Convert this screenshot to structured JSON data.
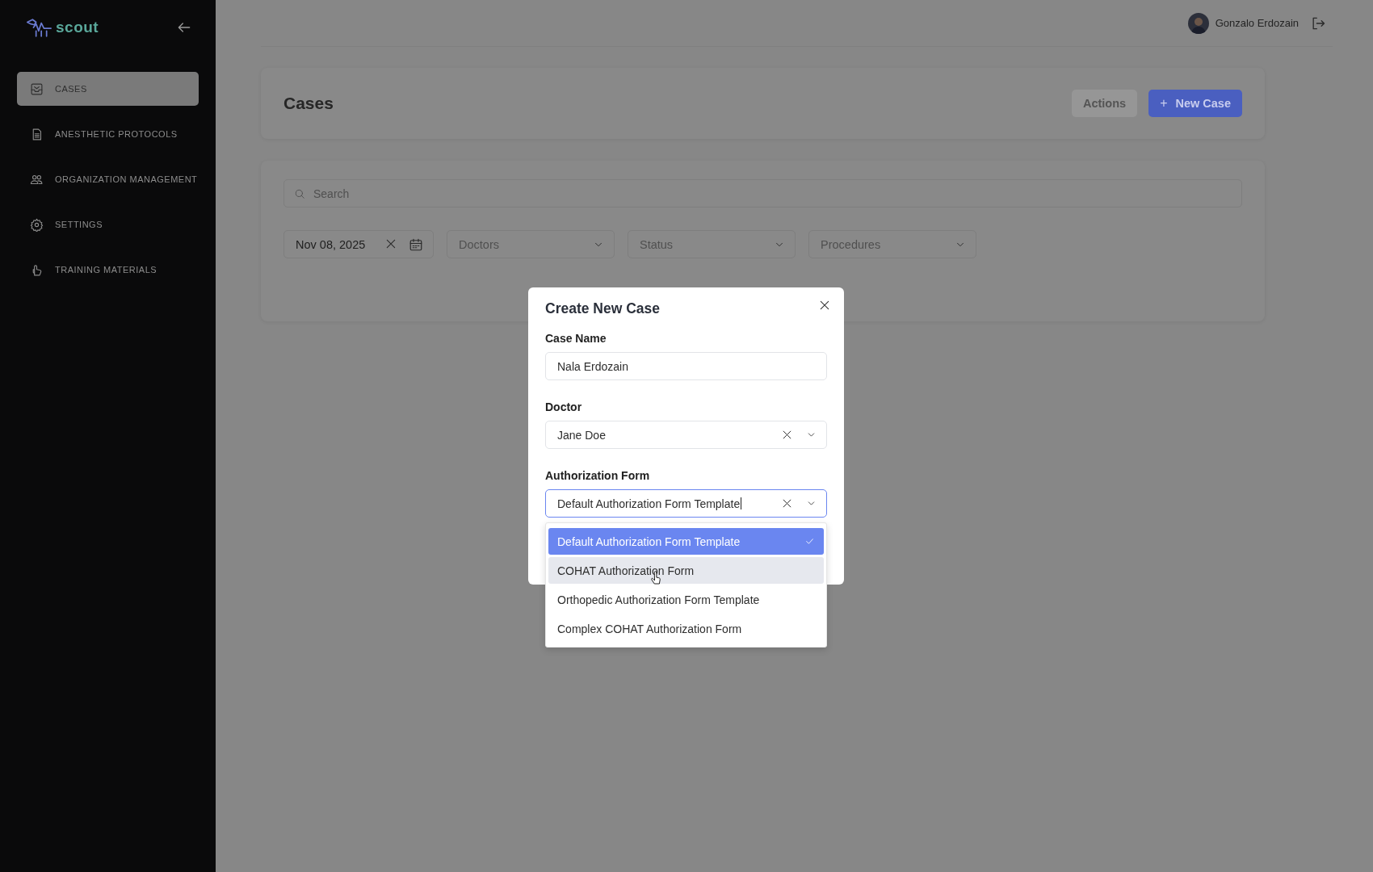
{
  "sidebar": {
    "logo": "scout",
    "items": [
      {
        "label": "CASES",
        "selected": true
      },
      {
        "label": "ANESTHETIC PROTOCOLS",
        "selected": false
      },
      {
        "label": "ORGANIZATION MANAGEMENT",
        "selected": false
      },
      {
        "label": "SETTINGS",
        "selected": false
      },
      {
        "label": "TRAINING MATERIALS",
        "selected": false
      }
    ]
  },
  "header": {
    "user_name": "Gonzalo Erdozain"
  },
  "page": {
    "title": "Cases",
    "buttons": [
      {
        "label": "Actions",
        "kind": "secondary",
        "disabled": true
      },
      {
        "label": "New Case",
        "kind": "primary",
        "icon": "+"
      }
    ]
  },
  "filters": {
    "search": {
      "placeholder": "Search"
    },
    "date": "Nov 08, 2025",
    "selects": [
      {
        "placeholder": "Doctors"
      },
      {
        "placeholder": "Status"
      },
      {
        "placeholder": "Procedures"
      }
    ]
  },
  "modal": {
    "title": "Create New Case",
    "fields": [
      {
        "label": "Case Name",
        "kind": "text",
        "value": "Nala Erdozain"
      },
      {
        "label": "Doctor",
        "kind": "select",
        "value": "Jane Doe",
        "focused": false
      },
      {
        "label": "Authorization Form",
        "kind": "select",
        "value": "Default Authorization Form Template",
        "focused": true
      }
    ],
    "dropdown": {
      "options": [
        {
          "label": "Default Authorization Form Template",
          "selected": true,
          "highlighted": false
        },
        {
          "label": "COHAT Authorization Form",
          "selected": false,
          "highlighted": true
        },
        {
          "label": "Orthopedic Authorization Form Template",
          "selected": false,
          "highlighted": false
        },
        {
          "label": "Complex COHAT Authorization Form",
          "selected": false,
          "highlighted": false
        }
      ]
    }
  }
}
